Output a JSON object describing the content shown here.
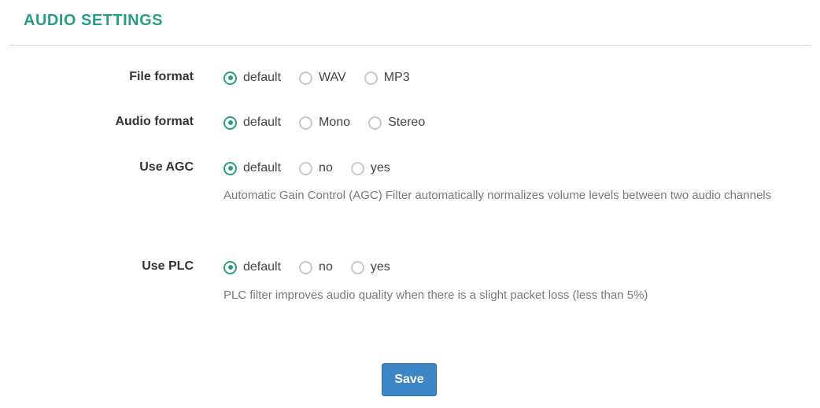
{
  "section": {
    "title": "AUDIO SETTINGS"
  },
  "fields": [
    {
      "label": "File format",
      "options": [
        "default",
        "WAV",
        "MP3"
      ],
      "selected": "default",
      "help": ""
    },
    {
      "label": "Audio format",
      "options": [
        "default",
        "Mono",
        "Stereo"
      ],
      "selected": "default",
      "help": ""
    },
    {
      "label": "Use AGC",
      "options": [
        "default",
        "no",
        "yes"
      ],
      "selected": "default",
      "help": "Automatic Gain Control (AGC) Filter automatically normalizes volume levels between two audio channels"
    },
    {
      "label": "Use PLC",
      "options": [
        "default",
        "no",
        "yes"
      ],
      "selected": "default",
      "help": "PLC filter improves audio quality when there is a slight packet loss (less than 5%)"
    }
  ],
  "actions": {
    "save_label": "Save"
  },
  "colors": {
    "accent": "#2a9d86",
    "button": "#3d86c6"
  }
}
